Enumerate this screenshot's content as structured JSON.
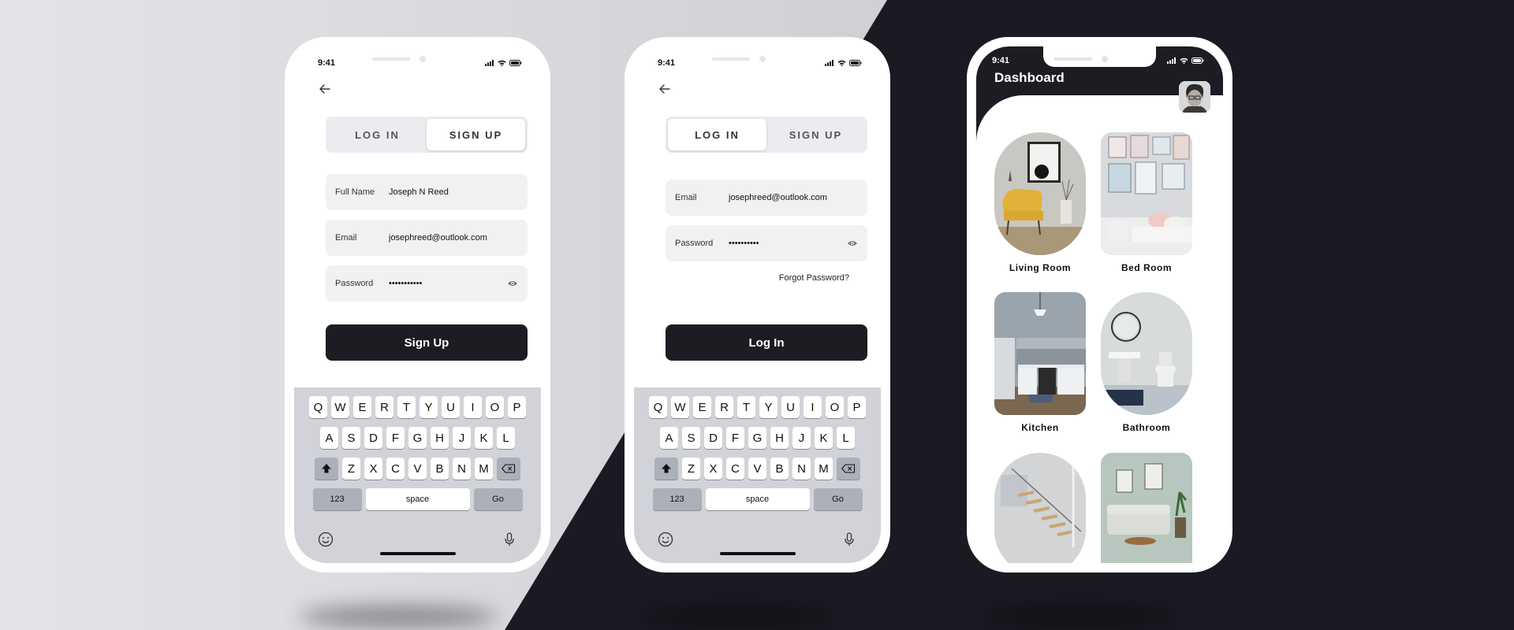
{
  "status_bar": {
    "time": "9:41"
  },
  "signup_screen": {
    "tabs": [
      {
        "label": "LOG IN"
      },
      {
        "label": "SIGN UP"
      }
    ],
    "fields": {
      "full_name": {
        "label": "Full Name",
        "value": "Joseph N Reed"
      },
      "email": {
        "label": "Email",
        "value": "josephreed@outlook.com"
      },
      "password": {
        "label": "Password",
        "value": "•••••••••••"
      }
    },
    "submit_label": "Sign Up"
  },
  "login_screen": {
    "tabs": [
      {
        "label": "LOG IN"
      },
      {
        "label": "SIGN UP"
      }
    ],
    "fields": {
      "email": {
        "label": "Email",
        "value": "josephreed@outlook.com"
      },
      "password": {
        "label": "Password",
        "value": "••••••••••"
      }
    },
    "forgot_label": "Forgot Password?",
    "submit_label": "Log In"
  },
  "keyboard": {
    "row1": [
      "Q",
      "W",
      "E",
      "R",
      "T",
      "Y",
      "U",
      "I",
      "O",
      "P"
    ],
    "row2": [
      "A",
      "S",
      "D",
      "F",
      "G",
      "H",
      "J",
      "K",
      "L"
    ],
    "row3": [
      "Z",
      "X",
      "C",
      "V",
      "B",
      "N",
      "M"
    ],
    "numbers_label": "123",
    "space_label": "space",
    "go_label": "Go"
  },
  "dashboard": {
    "title": "Dashboard",
    "rooms": [
      {
        "name": "Living Room"
      },
      {
        "name": "Bed Room"
      },
      {
        "name": "Kitchen"
      },
      {
        "name": "Bathroom"
      },
      {
        "name": ""
      },
      {
        "name": ""
      }
    ]
  }
}
